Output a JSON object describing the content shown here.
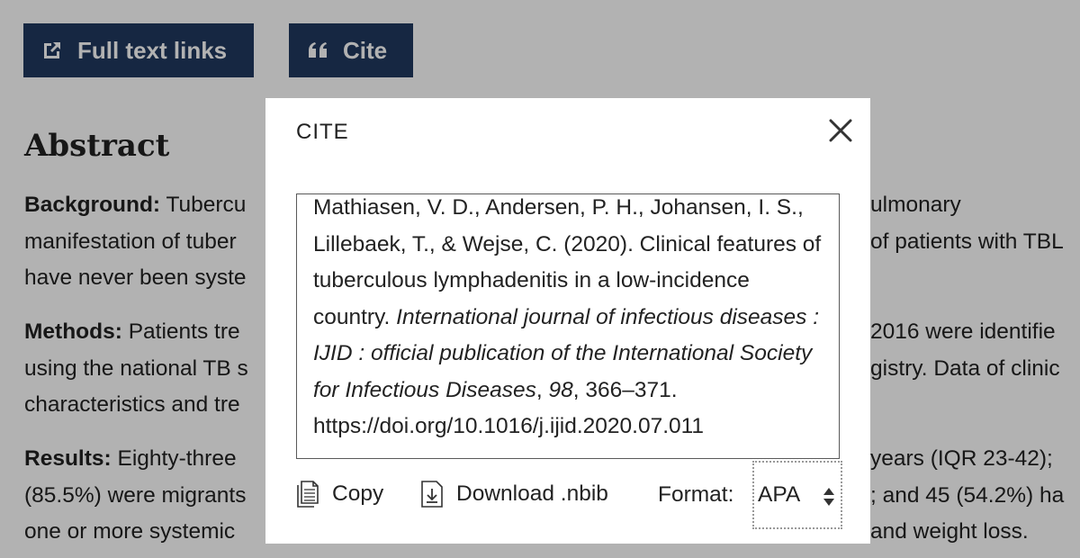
{
  "toolbar": {
    "full_text_label": "Full text links",
    "cite_label": "Cite"
  },
  "abstract": {
    "heading": "Abstract",
    "background": {
      "label": "Background:",
      "left": [
        "Tubercu",
        "manifestation of tuber",
        "have never been syste"
      ],
      "right": [
        "ulmonary",
        "of patients with TBL",
        ""
      ]
    },
    "methods": {
      "label": "Methods:",
      "left": [
        "Patients tre",
        "using the national TB s",
        "characteristics and tre"
      ],
      "right": [
        "2016 were identifie",
        "gistry. Data of clinic",
        ""
      ]
    },
    "results": {
      "label": "Results:",
      "left": [
        "Eighty-three",
        "(85.5%) were migrants",
        "one or more systemic"
      ],
      "right": [
        "years (IQR 23-42);",
        "; and 45 (54.2%) ha",
        "and weight loss."
      ]
    }
  },
  "modal": {
    "title": "CITE",
    "citation": {
      "authors_year_title": "Mathiasen, V. D., Andersen, P. H., Johansen, I. S., Lillebaek, T., & Wejse, C. (2020). Clinical features of tuberculous lymphadenitis in a low-incidence country.",
      "journal": "International journal of infectious diseases : IJID : official publication of the International Society for Infectious Diseases",
      "volume": "98",
      "pages": "366–371.",
      "doi": "https://doi.org/10.1016/j.ijid.2020.07.011"
    },
    "copy_label": "Copy",
    "download_label": "Download .nbib",
    "format_label": "Format:",
    "format_value": "APA"
  },
  "icons": {
    "full_text": "external-link-icon",
    "cite": "quote-icon",
    "close": "close-icon",
    "copy": "copy-icon",
    "download": "download-icon",
    "select": "select-arrows-icon"
  },
  "colors": {
    "primary_button": "#20385f",
    "overlay": "rgba(0,0,0,0.30)"
  }
}
